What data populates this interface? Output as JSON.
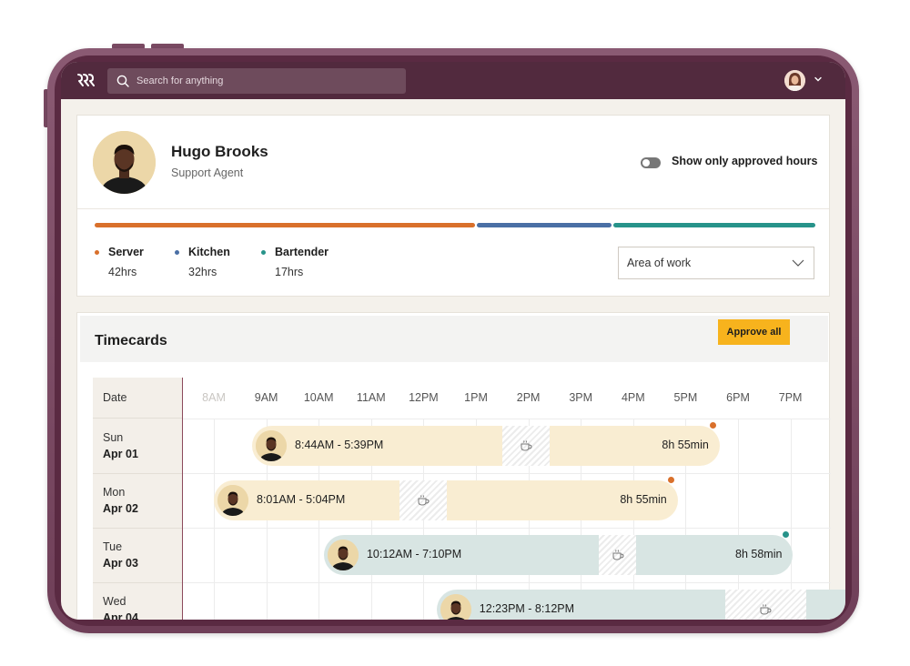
{
  "colors": {
    "device_frame": "#6f3f58",
    "topbar": "#522a3e",
    "server": "#d9702b",
    "kitchen": "#4a6fa5",
    "bartender": "#27938a",
    "approve_button": "#f7b31d",
    "shift_orange": "#f9edd2",
    "shift_teal": "#d8e5e3"
  },
  "topbar": {
    "logo_icon": "brand-logo-icon",
    "search_placeholder": "Search for anything",
    "search_icon": "search-icon",
    "user_menu_icon": "chevron-down-icon"
  },
  "profile": {
    "name": "Hugo Brooks",
    "role": "Support Agent",
    "toggle_label": "Show only approved hours",
    "toggle_on": false,
    "work_areas": [
      {
        "name": "Server",
        "hours": "42hrs",
        "color": "#d9702b",
        "share": 0.53
      },
      {
        "name": "Kitchen",
        "hours": "32hrs",
        "color": "#4a6fa5",
        "share": 0.19
      },
      {
        "name": "Bartender",
        "hours": "17hrs",
        "color": "#27938a",
        "share": 0.28
      }
    ],
    "area_select": {
      "value": "Area of work",
      "icon": "chevron-down-icon"
    }
  },
  "timecards": {
    "title": "Timecards",
    "approve_all_label": "Approve all",
    "date_header": "Date",
    "hours": [
      "8AM",
      "9AM",
      "10AM",
      "11AM",
      "12PM",
      "1PM",
      "2PM",
      "3PM",
      "4PM",
      "5PM",
      "6PM",
      "7PM"
    ],
    "rows": [
      {
        "day": "Sun",
        "date": "Apr 01",
        "range": "8:44AM - 5:39PM",
        "duration": "8h 55min",
        "color": "orange",
        "start": 8.73,
        "end": 17.65,
        "break_start": 13.5,
        "break_end": 14.4,
        "status_color": "#d9702b"
      },
      {
        "day": "Mon",
        "date": "Apr 02",
        "range": "8:01AM - 5:04PM",
        "duration": "8h 55min",
        "color": "orange",
        "start": 8.0,
        "end": 16.85,
        "break_start": 11.55,
        "break_end": 12.45,
        "status_color": "#d9702b"
      },
      {
        "day": "Tue",
        "date": "Apr 03",
        "range": "10:12AM - 7:10PM",
        "duration": "8h 58min",
        "color": "teal",
        "start": 10.1,
        "end": 19.05,
        "break_start": 15.35,
        "break_end": 16.05,
        "status_color": "#27938a"
      },
      {
        "day": "Wed",
        "date": "Apr 04",
        "range": "12:23PM - 8:12PM",
        "duration": "",
        "color": "teal",
        "start": 12.25,
        "end": 21.0,
        "break_start": 17.75,
        "break_end": 19.3,
        "status_color": ""
      }
    ]
  }
}
